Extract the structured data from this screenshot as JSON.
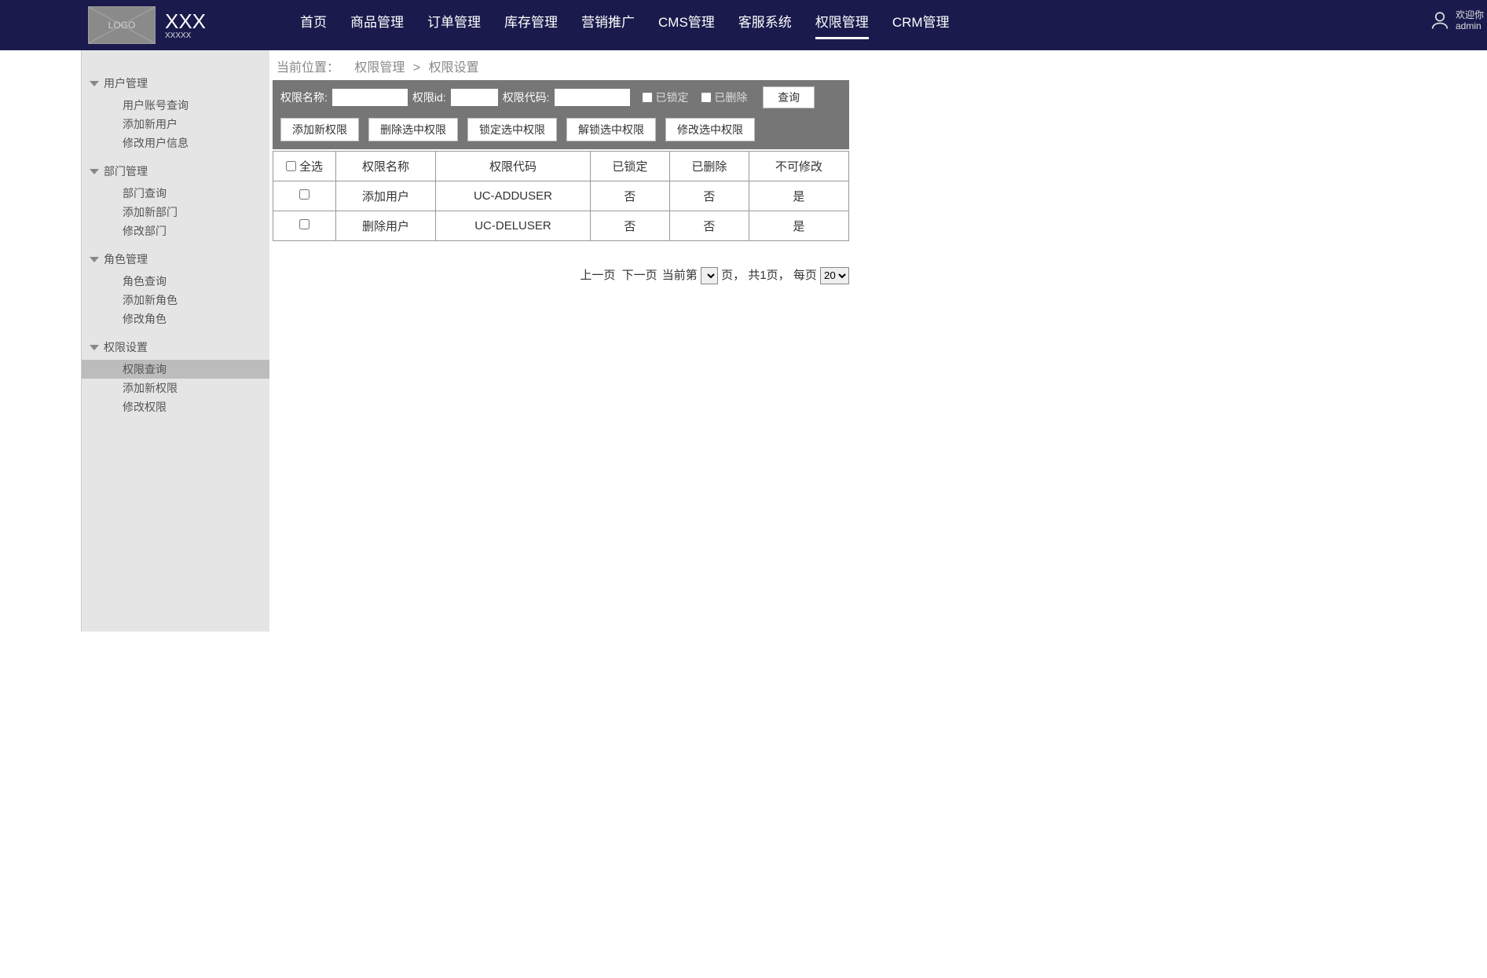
{
  "header": {
    "logo_text": "LOGO",
    "brand_title": "XXX",
    "brand_sub": "XXXXX",
    "nav": [
      "首页",
      "商品管理",
      "订单管理",
      "库存管理",
      "营销推广",
      "CMS管理",
      "客服系统",
      "权限管理",
      "CRM管理"
    ],
    "nav_active_index": 7,
    "welcome": "欢迎你",
    "username": "admin"
  },
  "sidebar": {
    "groups": [
      {
        "title": "用户管理",
        "items": [
          "用户账号查询",
          "添加新用户",
          "修改用户信息"
        ],
        "active_item": null
      },
      {
        "title": "部门管理",
        "items": [
          "部门查询",
          "添加新部门",
          "修改部门"
        ],
        "active_item": null
      },
      {
        "title": "角色管理",
        "items": [
          "角色查询",
          "添加新角色",
          "修改角色"
        ],
        "active_item": null
      },
      {
        "title": "权限设置",
        "items": [
          "权限查询",
          "添加新权限",
          "修改权限"
        ],
        "active_item": 0
      }
    ]
  },
  "breadcrumb": {
    "label": "当前位置：",
    "parts": [
      "权限管理",
      "权限设置"
    ],
    "sep": ">"
  },
  "filter": {
    "name_label": "权限名称:",
    "name_value": "",
    "id_label": "权限id:",
    "id_value": "",
    "code_label": "权限代码:",
    "code_value": "",
    "locked_label": "已锁定",
    "deleted_label": "已删除",
    "query_button": "查询",
    "action_buttons": [
      "添加新权限",
      "删除选中权限",
      "锁定选中权限",
      "解锁选中权限",
      "修改选中权限"
    ]
  },
  "table": {
    "select_all_label": "全选",
    "headers": [
      "权限名称",
      "权限代码",
      "已锁定",
      "已删除",
      "不可修改"
    ],
    "rows": [
      {
        "name": "添加用户",
        "code": "UC-ADDUSER",
        "locked": "否",
        "deleted": "否",
        "immutable": "是"
      },
      {
        "name": "删除用户",
        "code": "UC-DELUSER",
        "locked": "否",
        "deleted": "否",
        "immutable": "是"
      }
    ]
  },
  "pager": {
    "prev": "上一页",
    "next": "下一页",
    "current_label": "当前第",
    "page_suffix": "页，",
    "total_label": "共1页，",
    "per_page_label": "每页",
    "per_page_value": "20"
  }
}
